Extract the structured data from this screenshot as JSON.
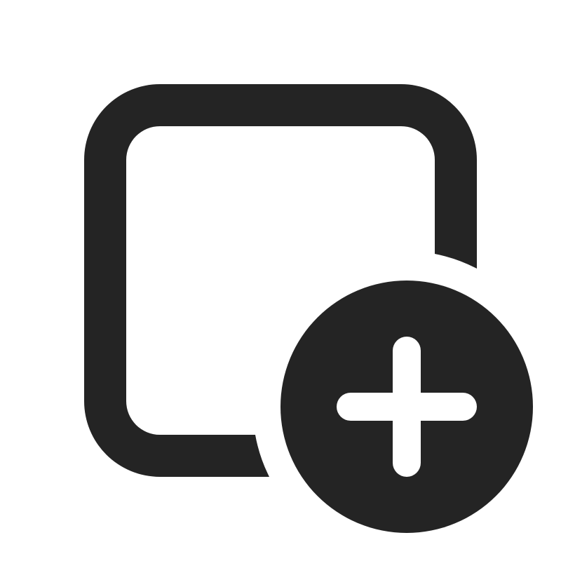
{
  "icon": {
    "name": "square-add-icon",
    "parts": [
      "square-outline",
      "add-circle",
      "plus-sign"
    ]
  },
  "colors": {
    "background": "#ffffff",
    "ink": "#242424",
    "plus": "#ffffff"
  }
}
